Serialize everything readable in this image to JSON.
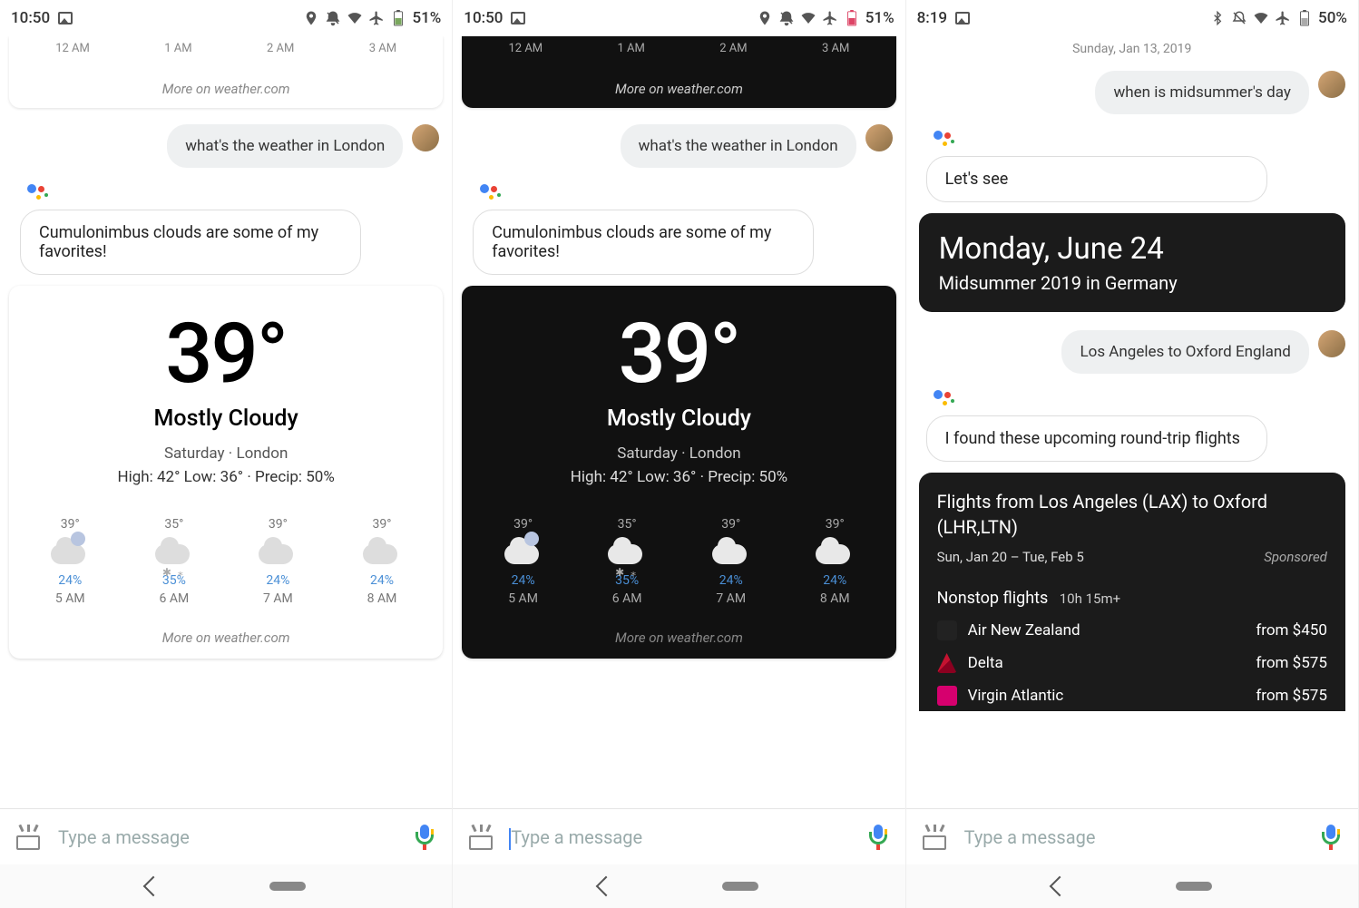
{
  "screens": [
    {
      "status": {
        "time": "10:50",
        "battery": "51%",
        "icons": [
          "location",
          "dnd",
          "wifi",
          "airplane",
          "battery"
        ]
      },
      "top_card": {
        "theme": "light",
        "times": [
          "12 AM",
          "1 AM",
          "2 AM",
          "3 AM"
        ],
        "more": "More on weather.com"
      },
      "user_msg": "what's the weather in London",
      "assist_msg": "Cumulonimbus clouds are some of my favorites!",
      "weather": {
        "theme": "light",
        "temp": "39°",
        "cond": "Mostly Cloudy",
        "loc": "Saturday · London",
        "detail": "High: 42° Low: 36° · Precip: 50%",
        "hours": [
          {
            "t": "39°",
            "icon": "moon",
            "p": "24%",
            "time": "5 AM"
          },
          {
            "t": "35°",
            "icon": "snow",
            "p": "35%",
            "time": "6 AM"
          },
          {
            "t": "39°",
            "icon": "cloud",
            "p": "24%",
            "time": "7 AM"
          },
          {
            "t": "39°",
            "icon": "cloud",
            "p": "24%",
            "time": "8 AM"
          }
        ],
        "more": "More on weather.com"
      },
      "input_placeholder": "Type a message"
    },
    {
      "status": {
        "time": "10:50",
        "battery": "51%",
        "icons": [
          "location",
          "dnd",
          "wifi",
          "airplane",
          "battery-low"
        ]
      },
      "top_card": {
        "theme": "dark",
        "times": [
          "12 AM",
          "1 AM",
          "2 AM",
          "3 AM"
        ],
        "more": "More on weather.com"
      },
      "user_msg": "what's the weather in London",
      "assist_msg": "Cumulonimbus clouds are some of my favorites!",
      "weather": {
        "theme": "dark",
        "temp": "39°",
        "cond": "Mostly Cloudy",
        "loc": "Saturday · London",
        "detail": "High: 42° Low: 36° · Precip: 50%",
        "hours": [
          {
            "t": "39°",
            "icon": "moon",
            "p": "24%",
            "time": "5 AM"
          },
          {
            "t": "35°",
            "icon": "snow",
            "p": "35%",
            "time": "6 AM"
          },
          {
            "t": "39°",
            "icon": "cloud",
            "p": "24%",
            "time": "7 AM"
          },
          {
            "t": "39°",
            "icon": "cloud",
            "p": "24%",
            "time": "8 AM"
          }
        ],
        "more": "More on weather.com"
      },
      "input_placeholder": "Type a message"
    },
    {
      "status": {
        "time": "8:19",
        "battery": "50%",
        "icons": [
          "bluetooth",
          "dnd",
          "wifi",
          "airplane",
          "battery"
        ]
      },
      "date": "Sunday, Jan 13, 2019",
      "user_msg1": "when is midsummer's day",
      "assist_msg1": "Let's see",
      "answer": {
        "title": "Monday, June 24",
        "sub": "Midsummer 2019 in Germany"
      },
      "user_msg2": "Los Angeles to Oxford England",
      "assist_msg2": "I found these upcoming round-trip flights",
      "flights": {
        "title": "Flights from Los Angeles (LAX) to Oxford (LHR,LTN)",
        "dates": "Sun, Jan 20 – Tue, Feb 5",
        "sponsored": "Sponsored",
        "nonstop_label": "Nonstop flights",
        "duration": "10h 15m+",
        "rows": [
          {
            "airline": "Air New Zealand",
            "price": "from $450",
            "color": "#222"
          },
          {
            "airline": "Delta",
            "price": "from $575",
            "color": "#c41230"
          },
          {
            "airline": "Virgin Atlantic",
            "price": "from $575",
            "color": "#d6006e"
          }
        ]
      },
      "input_placeholder": "Type a message"
    }
  ]
}
